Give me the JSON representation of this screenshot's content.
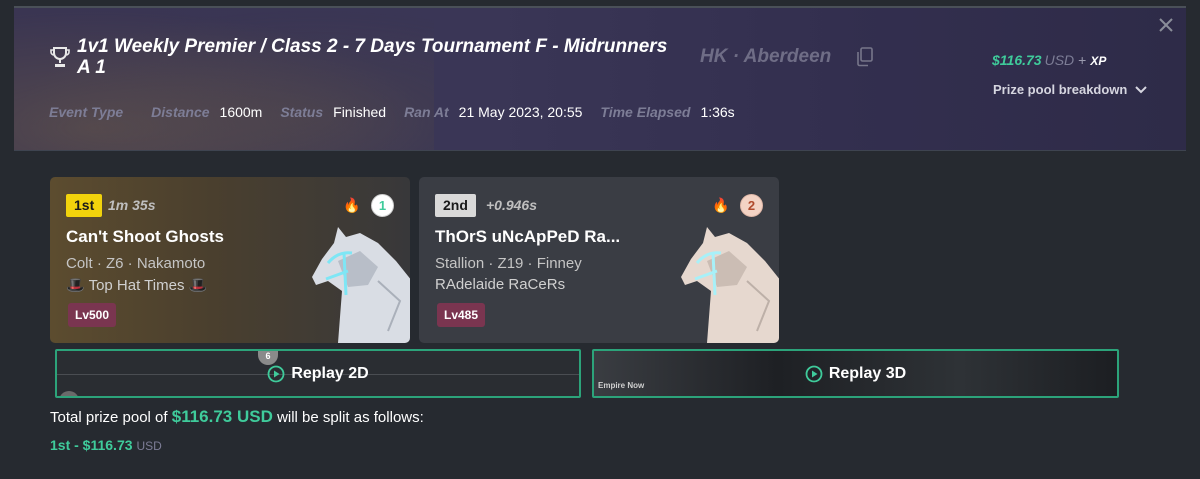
{
  "event": {
    "title": "1v1 Weekly Premier / Class 2 - 7 Days Tournament F - Midrunners A 1",
    "location": "HK · Aberdeen",
    "meta": [
      {
        "label": "Event Type",
        "value": ""
      },
      {
        "label": "Distance",
        "value": "1600m"
      },
      {
        "label": "Status",
        "value": "Finished"
      },
      {
        "label": "Ran At",
        "value": "21 May 2023, 20:55"
      },
      {
        "label": "Time Elapsed",
        "value": "1:36s"
      }
    ],
    "prize": {
      "amount": "$116.73",
      "currency": "USD",
      "plus": "+",
      "xp": "XP"
    },
    "breakdown_label": "Prize pool breakdown"
  },
  "results": [
    {
      "position": "1st",
      "time": "1m 35s",
      "gate": "1",
      "name": "Can't Shoot Ghosts",
      "info": "Colt · Z6 · Nakamoto",
      "stable": "🎩 Top Hat Times 🎩",
      "level": "Lv500",
      "fire": "🔥"
    },
    {
      "position": "2nd",
      "time": "+0.946s",
      "gate": "2",
      "name": "ThOrS uNcApPeD Ra...",
      "info": "Stallion · Z19 · Finney",
      "stable": "RAdelaide RaCeRs",
      "level": "Lv485",
      "fire": "🔥"
    }
  ],
  "replay": {
    "replay_2d": "Replay 2D",
    "replay_3d": "Replay 3D",
    "marker": "6",
    "overlay_text": "Empire Now"
  },
  "split": {
    "prefix": "Total prize pool of",
    "amount": "$116.73 USD",
    "suffix": "will be split as follows:",
    "payouts": [
      {
        "place": "1st - $116.73",
        "currency": "USD"
      }
    ]
  },
  "colors": {
    "accent": "#3fcb9b",
    "first_badge": "#f2d30c",
    "level_badge": "#7a3550"
  }
}
